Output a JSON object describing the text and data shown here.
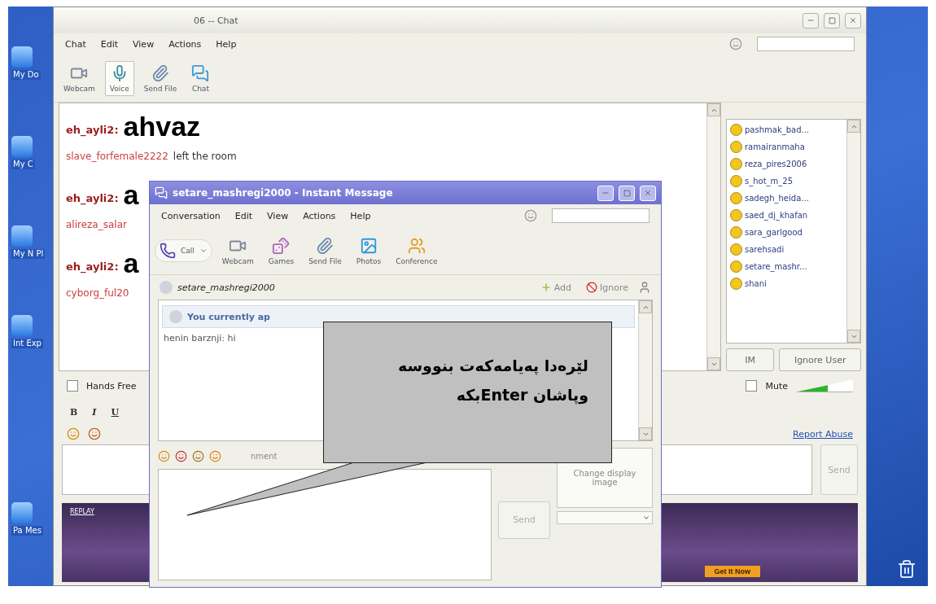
{
  "desktop": {
    "icons": [
      {
        "label": "My Do"
      },
      {
        "label": "My C"
      },
      {
        "label": "My N Pl"
      },
      {
        "label": "Int Exp"
      },
      {
        "label": "Pa Mes"
      }
    ]
  },
  "chat_window": {
    "title": "06 -- Chat",
    "menu": [
      "Chat",
      "Edit",
      "View",
      "Actions",
      "Help"
    ],
    "toolbar": [
      {
        "kind": "webcam",
        "label": "Webcam",
        "selected": false
      },
      {
        "kind": "voice",
        "label": "Voice",
        "selected": true
      },
      {
        "kind": "file",
        "label": "Send File",
        "selected": false
      },
      {
        "kind": "chat",
        "label": "Chat",
        "selected": false
      }
    ],
    "messages": [
      {
        "kind": "big",
        "user": "eh_ayli2:",
        "text": "ahvaz"
      },
      {
        "kind": "event",
        "user": "slave_forfemale2222",
        "text": "left the room"
      },
      {
        "kind": "big",
        "user": "eh_ayli2:",
        "text": "a"
      },
      {
        "kind": "event",
        "user": "alireza_salar"
      },
      {
        "kind": "big",
        "user": "eh_ayli2:",
        "text": "a"
      },
      {
        "kind": "event",
        "user": "cyborg_ful20"
      }
    ],
    "users": [
      {
        "name": "pashmak_bad..."
      },
      {
        "name": "ramairanmaha"
      },
      {
        "name": "reza_pires2006"
      },
      {
        "name": "s_hot_m_25"
      },
      {
        "name": "sadegh_heida..."
      },
      {
        "name": "saed_dj_khafan"
      },
      {
        "name": "sara_garlgood"
      },
      {
        "name": "sarehsadi"
      },
      {
        "name": "setare_mashr..."
      },
      {
        "name": "shani"
      }
    ],
    "user_buttons": [
      "IM",
      "Ignore User"
    ],
    "hands_free": {
      "label": "Hands Free",
      "checked": false
    },
    "mute": {
      "label": "Mute",
      "checked": false
    },
    "volume": {
      "level": 0.55
    },
    "format_buttons": [
      "B",
      "I",
      "U"
    ],
    "report_link": "Report Abuse",
    "send": "Send",
    "ad": {
      "tag": "REPLAY",
      "button": "Get It Now"
    }
  },
  "im_window": {
    "title": "setare_mashregi2000 - Instant Message",
    "menu": [
      "Conversation",
      "Edit",
      "View",
      "Actions",
      "Help"
    ],
    "call": "Call",
    "toolbar": [
      {
        "kind": "webcam",
        "label": "Webcam"
      },
      {
        "kind": "games",
        "label": "Games"
      },
      {
        "kind": "file",
        "label": "Send File"
      },
      {
        "kind": "photos",
        "label": "Photos"
      },
      {
        "kind": "conference",
        "label": "Conference"
      }
    ],
    "contact": "setare_mashregi2000",
    "add": "Add",
    "ignore": "Ignore",
    "notice": "You currently ap",
    "messages": [
      {
        "user": "henin barznji:",
        "text": "hi"
      }
    ],
    "imvironment": "nment",
    "send": "Send",
    "display_image": "Change display image"
  },
  "callout": {
    "lines": [
      "لێرەدا پەیامەکەت بنووسە",
      "وپاشان Enterبکە"
    ]
  }
}
